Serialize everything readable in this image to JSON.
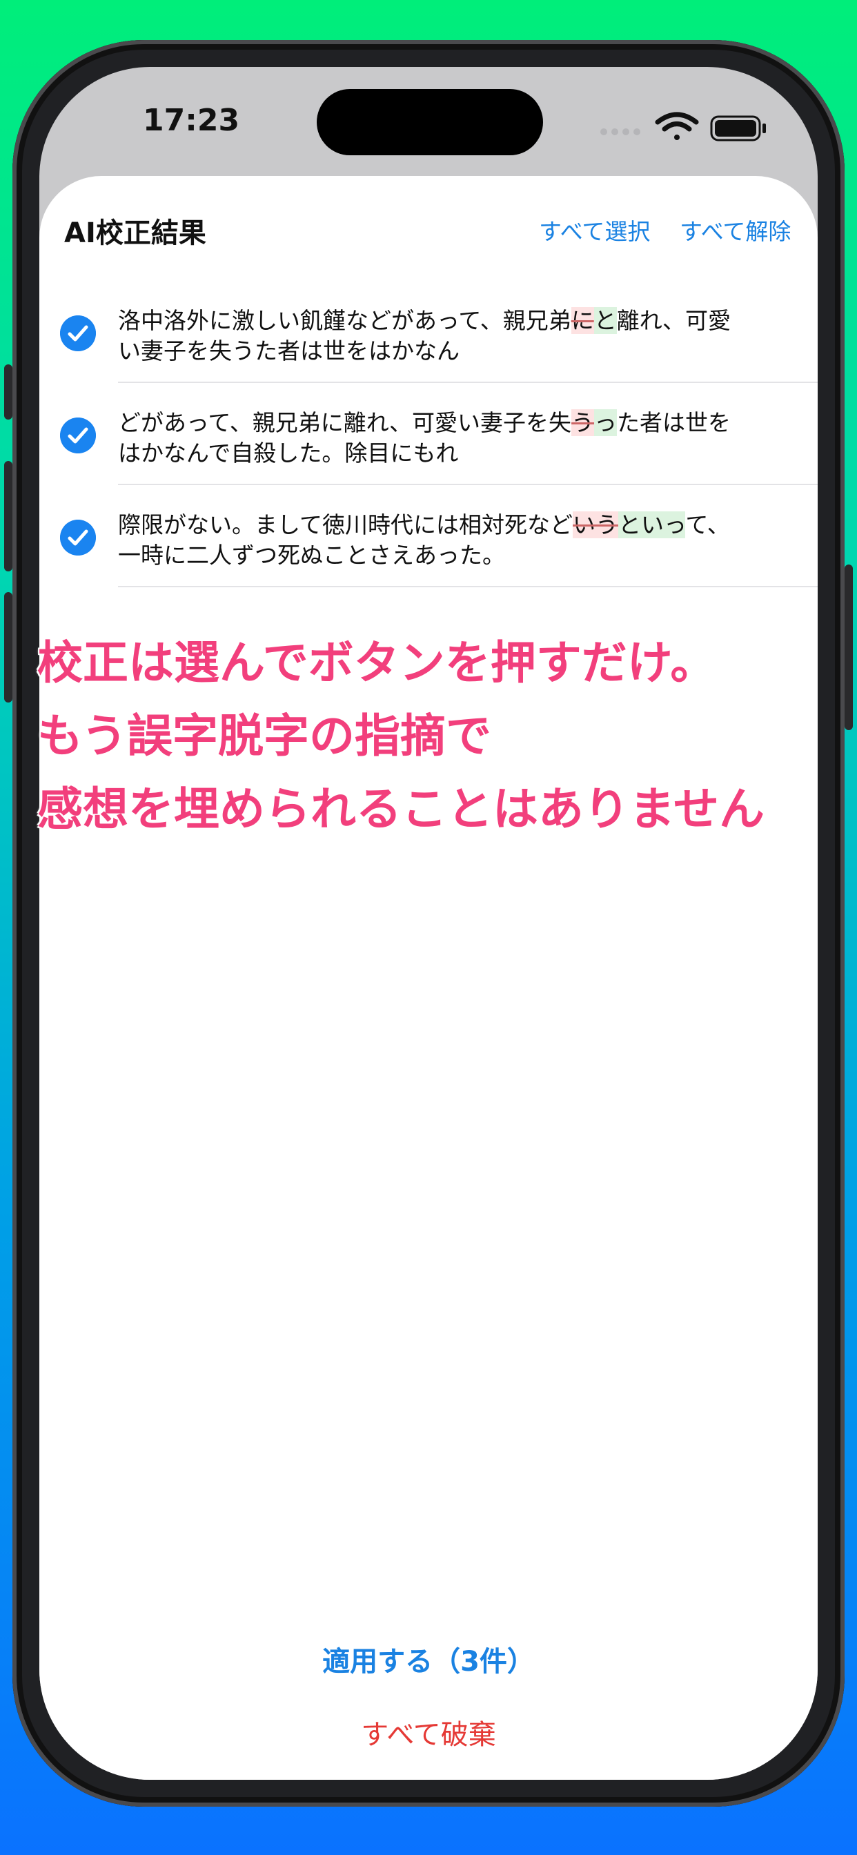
{
  "status_bar": {
    "time": "17:23"
  },
  "sheet": {
    "title": "AI校正結果",
    "select_all": "すべて選択",
    "deselect_all": "すべて解除"
  },
  "corrections": [
    {
      "checked": true,
      "line1_before": "洛中洛外に激しい飢饉などがあって、親兄弟",
      "del": "に",
      "ins": "と",
      "line1_after": "離れ、可愛",
      "line2": "い妻子を失うた者は世をはかなん"
    },
    {
      "checked": true,
      "line1_before": "どがあって、親兄弟に離れ、可愛い妻子を失",
      "del": "う",
      "ins": "っ",
      "line1_after": "た者は世を",
      "line2": "はかなんで自殺した。除目にもれ"
    },
    {
      "checked": true,
      "line1_before": "際限がない。まして徳川時代には相対死など",
      "del": "いう",
      "ins": "といっ",
      "line1_after": "て、",
      "line2": "一時に二人ずつ死ぬことさえあった。"
    }
  ],
  "promo": {
    "line1": "校正は選んでボタンを押すだけ。",
    "line2": "もう誤字脱字の指摘で",
    "line3": "感想を埋められることはありません"
  },
  "actions": {
    "apply": "適用する（3件）",
    "discard": "すべて破棄"
  },
  "colors": {
    "accent": "#1a82e2",
    "destructive": "#e53935",
    "promo": "#f23f7c"
  }
}
